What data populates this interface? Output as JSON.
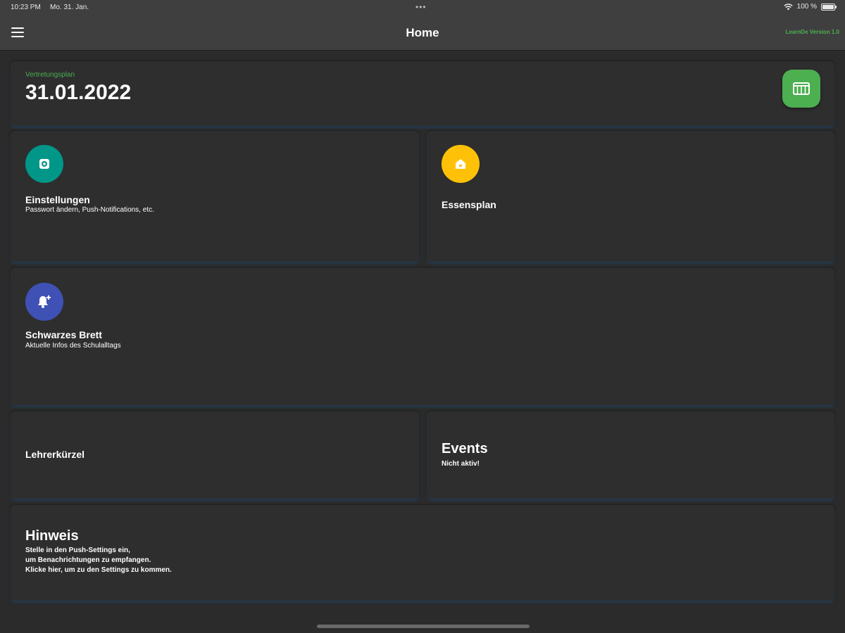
{
  "status_bar": {
    "time": "10:23 PM",
    "date": "Mo. 31. Jan.",
    "dots": "•••",
    "battery_text": "100 %"
  },
  "nav": {
    "title": "Home",
    "version": "LearnDe Version 1.0"
  },
  "vertretungsplan": {
    "label": "Vertretungsplan",
    "date": "31.01.2022"
  },
  "einstellungen": {
    "title": "Einstellungen",
    "subtitle": "Passwort ändern, Push-Notifications, etc."
  },
  "essensplan": {
    "title": "Essensplan"
  },
  "schwarzes_brett": {
    "title": "Schwarzes Brett",
    "subtitle": "Aktuelle Infos des Schulalltags"
  },
  "lehrerkuerzel": {
    "title": "Lehrerkürzel"
  },
  "events": {
    "title": "Events",
    "subtitle": "Nicht aktiv!"
  },
  "hinweis": {
    "title": "Hinweis",
    "line1": "Stelle in den Push-Settings ein,",
    "line2": "um Benachrichtungen zu empfangen.",
    "line3": "Klicke hier, um zu den Settings zu kommen."
  },
  "colors": {
    "accent_green": "#4caf50",
    "teal": "#009688",
    "amber": "#ffc107",
    "indigo": "#3f51b5"
  },
  "icons": {
    "menu": "hamburger-icon",
    "calendar": "calendar-grid-icon",
    "settings": "gear-icon",
    "food": "house-icon",
    "bell": "bell-plus-icon",
    "wifi": "wifi-icon",
    "battery": "battery-icon"
  }
}
